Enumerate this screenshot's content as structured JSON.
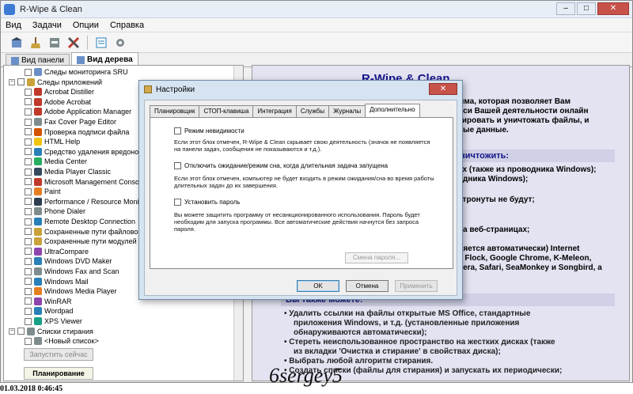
{
  "window": {
    "title": "R-Wipe & Clean",
    "min": "‒",
    "max": "□",
    "close": "✕"
  },
  "menu": [
    "Вид",
    "Задачи",
    "Опции",
    "Справка"
  ],
  "view_tabs": [
    {
      "label": "Вид панели",
      "active": false
    },
    {
      "label": "Вид дерева",
      "active": true
    }
  ],
  "tree": {
    "items": [
      {
        "label": "Следы мониторинга SRU",
        "level": 2,
        "color": "#6b8fc7"
      },
      {
        "label": "Следы приложений",
        "level": 0,
        "color": "#c9a23b"
      },
      {
        "label": "Acrobat Distiller",
        "level": 1,
        "color": "#c0392b"
      },
      {
        "label": "Adobe Acrobat",
        "level": 1,
        "color": "#c0392b"
      },
      {
        "label": "Adobe Application Manager",
        "level": 1,
        "color": "#c0392b"
      },
      {
        "label": "Fax Cover Page Editor",
        "level": 1,
        "color": "#7f8c8d"
      },
      {
        "label": "Проверка подписи файла",
        "level": 1,
        "color": "#d35400"
      },
      {
        "label": "HTML Help",
        "level": 1,
        "color": "#f1c40f"
      },
      {
        "label": "Средство удаления вредоносн",
        "level": 1,
        "color": "#2980b9"
      },
      {
        "label": "Media Center",
        "level": 1,
        "color": "#27ae60"
      },
      {
        "label": "Media Player Classic",
        "level": 1,
        "color": "#34495e"
      },
      {
        "label": "Microsoft Management Consol",
        "level": 1,
        "color": "#c0392b"
      },
      {
        "label": "Paint",
        "level": 1,
        "color": "#e67e22"
      },
      {
        "label": "Performance / Resource Monit",
        "level": 1,
        "color": "#2c3e50"
      },
      {
        "label": "Phone Dialer",
        "level": 1,
        "color": "#7f8c8d"
      },
      {
        "label": "Remote Desktop Connection",
        "level": 1,
        "color": "#2980b9"
      },
      {
        "label": "Сохраненные пути файлового",
        "level": 1,
        "color": "#c9a23b"
      },
      {
        "label": "Сохраненные пути модулей C",
        "level": 1,
        "color": "#c9a23b"
      },
      {
        "label": "UltraCompare",
        "level": 1,
        "color": "#8e44ad"
      },
      {
        "label": "Windows DVD Maker",
        "level": 1,
        "color": "#2980b9"
      },
      {
        "label": "Windows Fax and Scan",
        "level": 1,
        "color": "#7f8c8d"
      },
      {
        "label": "Windows Mail",
        "level": 1,
        "color": "#2980b9"
      },
      {
        "label": "Windows Media Player",
        "level": 1,
        "color": "#e67e22"
      },
      {
        "label": "WinRAR",
        "level": 1,
        "color": "#8e44ad"
      },
      {
        "label": "Wordpad",
        "level": 1,
        "color": "#2980b9"
      },
      {
        "label": "XPS Viewer",
        "level": 1,
        "color": "#16a085"
      },
      {
        "label": "Списки стирания",
        "level": 0,
        "color": "#7f8c8d"
      },
      {
        "label": "<Новый список>",
        "level": 1,
        "color": "#7f8c8d"
      }
    ],
    "run_now": "Запустить сейчас",
    "planning": "Планирование"
  },
  "content": {
    "heading": "R-Wipe & Clean",
    "intro_lines": [
      "мма, которая позволяет Вам",
      "иси Вашей деятельности онлайн",
      "тировать и уничтожать файлы, и",
      "ные данные."
    ],
    "section1": "уничтожить:",
    "mid_lines": [
      "ах (также из проводника Windows);",
      "одника Windows);",
      "",
      "атронуты не будут;",
      "",
      "на веб-страницах;",
      "",
      "",
      "ляется автоматически) Internet",
      "l, Flock, Google Chrome, K-Meleon,",
      "pera, Safari, SeaMonkey и Songbird, а"
    ],
    "section2": "Вы также можете:",
    "bullets": [
      "Удалить ссылки на файлы открытые MS Office, стандартные",
      "приложения Windows, и т.д. (установленные приложения",
      "обнаруживаются автоматически);",
      "Стереть неиспользованное пространство на жестких дисках (также",
      "из вкладки 'Очистка и стирание' в свойствах диска);",
      "Выбрать любой алгоритм стирания.",
      "Создать списки (файлы для стирания) и запускать их периодически;"
    ]
  },
  "dialog": {
    "title": "Настройки",
    "tabs": [
      {
        "label": "Планировщик",
        "active": false
      },
      {
        "label": "СТОП-клавиша",
        "active": false
      },
      {
        "label": "Интеграция",
        "active": false
      },
      {
        "label": "Службы",
        "active": false
      },
      {
        "label": "Журналы",
        "active": false
      },
      {
        "label": "Дополнительно",
        "active": true
      }
    ],
    "opt1_label": "Режим невидимости",
    "opt1_desc": "Если этот блок отмечен, R-Wipe & Clean скрывает свою деятельность (значок не появляется на панели задач, сообщения не показываются и т.д.).",
    "opt2_label": "Отключить ожидание/режим сна, когда длительная задача запущена",
    "opt2_desc": "Если этот блок отмечен, компьютер не будет входить в режим ожидания/сна во время работы длительных задач до их завершения.",
    "opt3_label": "Установить пароль",
    "opt3_desc": "Вы можете защитить программу от несанкционированного использования. Пароль будет необходим для запуска программы. Все автоматические действия начнутся без запроса пароля.",
    "change_password": "Смена пароля...",
    "ok": "OK",
    "cancel": "Отмена",
    "apply": "Применить"
  },
  "footer": {
    "timestamp": "01.03.2018 0:46:45",
    "watermark": "6sergey5"
  }
}
